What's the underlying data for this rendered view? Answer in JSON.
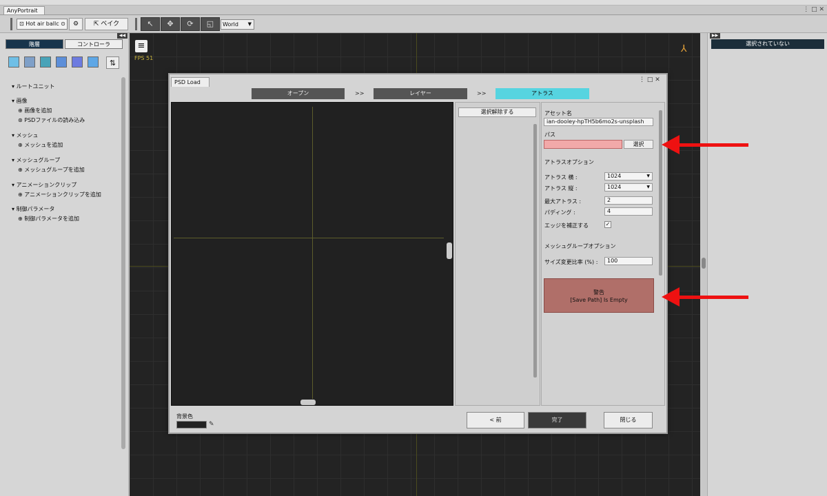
{
  "app": {
    "title": "AnyPortrait"
  },
  "toolbar": {
    "mesh_selector": "Hot air ballc",
    "bake_label": "ベイク",
    "space_selector": "World"
  },
  "left_panel": {
    "tabs": [
      "階層",
      "コントローラ"
    ],
    "tree": {
      "root": "ルートユニット",
      "images": "画像",
      "add_image": "画像を追加",
      "load_psd": "PSDファイルの読み込み",
      "mesh": "メッシュ",
      "add_mesh": "メッシュを追加",
      "mesh_group": "メッシュグループ",
      "add_mesh_group": "メッシュグループを追加",
      "anim_clip": "アニメーションクリップ",
      "add_anim_clip": "アニメーションクリップを追加",
      "control_param": "制御パラメータ",
      "add_control_param": "制御パラメータを追加"
    }
  },
  "viewport": {
    "fps": "FPS 51"
  },
  "right_panel": {
    "status": "選択されていない"
  },
  "dialog": {
    "tab": "PSD Load",
    "steps": [
      "オープン",
      "レイヤー",
      "アトラス"
    ],
    "step_separator": ">>",
    "active_step": 2,
    "deselect_button": "選択解除する",
    "asset_name_label": "アセット名",
    "asset_name_value": "ian-dooley-hpTH5b6mo2s-unsplash",
    "path_label": "パス",
    "path_value": "",
    "path_select_button": "選択",
    "atlas_options_label": "アトラスオプション",
    "atlas_width_label": "アトラス 横 :",
    "atlas_width_value": "1024",
    "atlas_height_label": "アトラス 縦 :",
    "atlas_height_value": "1024",
    "max_atlas_label": "最大アトラス :",
    "max_atlas_value": "2",
    "padding_label": "パディング :",
    "padding_value": "4",
    "edge_fix_label": "エッジを補正する",
    "edge_fix_checked": "✓",
    "mesh_group_options_label": "メッシュグループオプション",
    "resize_ratio_label": "サイズ変更比率 (%) :",
    "resize_ratio_value": "100",
    "warning_title": "警告",
    "warning_message": "[Save Path] Is Empty",
    "bg_color_label": "背景色",
    "prev_button": "< 前",
    "done_button": "完了",
    "close_button": "閉じる"
  },
  "colors": {
    "accent_step": "#56d4e0",
    "warning_bg": "#b06f69",
    "path_error_bg": "#f2a9a9",
    "annotation_arrow": "#ee1111"
  }
}
